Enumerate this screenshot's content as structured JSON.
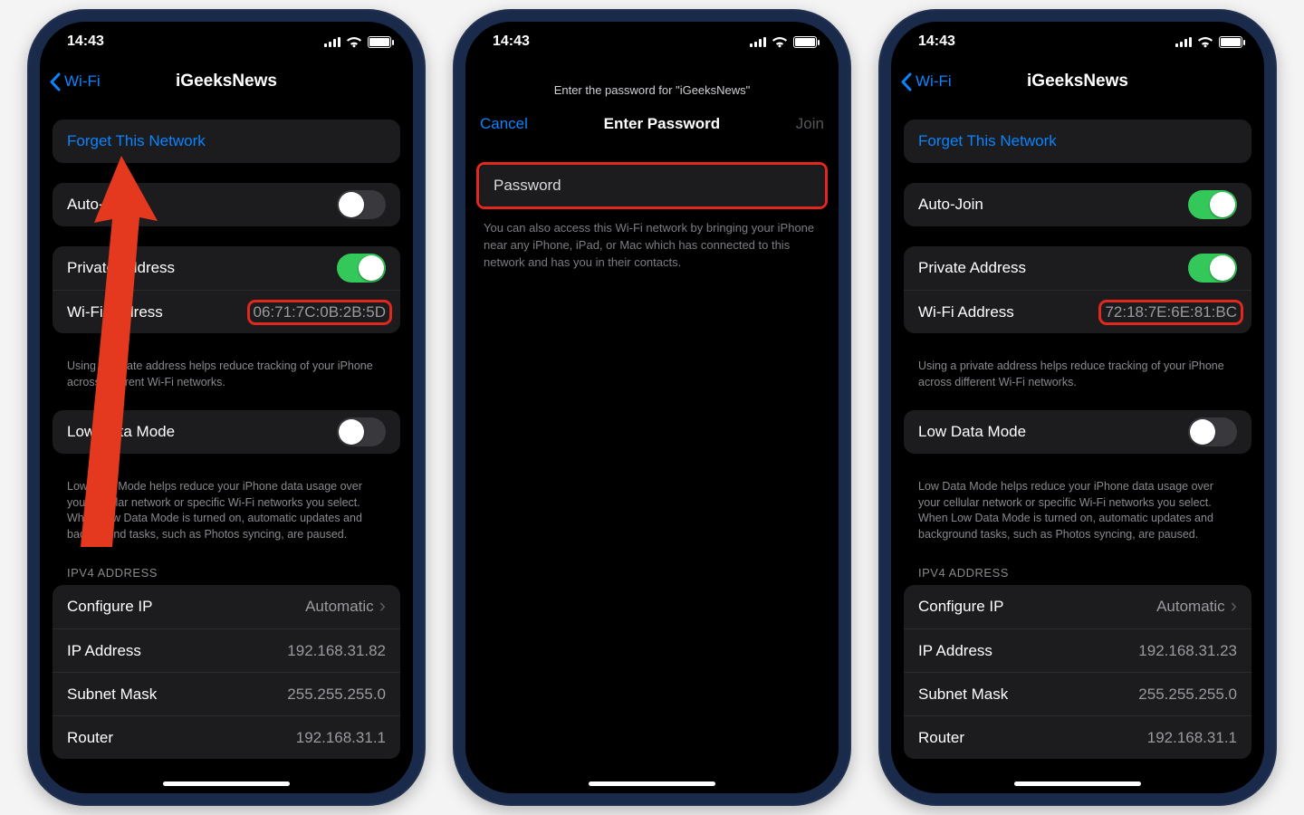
{
  "time": "14:43",
  "network_name": "iGeeksNews",
  "back_label": "Wi-Fi",
  "phoneA": {
    "forget": "Forget This Network",
    "auto_join_label": "Auto-Join",
    "auto_join_on": false,
    "private_addr_label": "Private Address",
    "private_addr_on": true,
    "wifi_addr_label": "Wi-Fi Address",
    "wifi_addr_value": "06:71:7C:0B:2B:5D",
    "private_footer": "Using a private address helps reduce tracking of your iPhone across different Wi-Fi networks.",
    "low_data_label": "Low Data Mode",
    "low_data_on": false,
    "low_data_footer": "Low Data Mode helps reduce your iPhone data usage over your cellular network or specific Wi-Fi networks you select. When Low Data Mode is turned on, automatic updates and background tasks, such as Photos syncing, are paused.",
    "ipv4_header": "IPV4 ADDRESS",
    "configure_ip_label": "Configure IP",
    "configure_ip_value": "Automatic",
    "ip_addr_label": "IP Address",
    "ip_addr_value": "192.168.31.82",
    "subnet_label": "Subnet Mask",
    "subnet_value": "255.255.255.0",
    "router_label": "Router",
    "router_value": "192.168.31.1"
  },
  "phoneB": {
    "prompt": "Enter the password for \"iGeeksNews\"",
    "cancel": "Cancel",
    "title": "Enter Password",
    "join": "Join",
    "password_label": "Password",
    "note": "You can also access this Wi-Fi network by bringing your iPhone near any iPhone, iPad, or Mac which has connected to this network and has you in their contacts."
  },
  "phoneC": {
    "forget": "Forget This Network",
    "auto_join_label": "Auto-Join",
    "auto_join_on": true,
    "private_addr_label": "Private Address",
    "private_addr_on": true,
    "wifi_addr_label": "Wi-Fi Address",
    "wifi_addr_value": "72:18:7E:6E:81:BC",
    "private_footer": "Using a private address helps reduce tracking of your iPhone across different Wi-Fi networks.",
    "low_data_label": "Low Data Mode",
    "low_data_on": false,
    "low_data_footer": "Low Data Mode helps reduce your iPhone data usage over your cellular network or specific Wi-Fi networks you select. When Low Data Mode is turned on, automatic updates and background tasks, such as Photos syncing, are paused.",
    "ipv4_header": "IPV4 ADDRESS",
    "configure_ip_label": "Configure IP",
    "configure_ip_value": "Automatic",
    "ip_addr_label": "IP Address",
    "ip_addr_value": "192.168.31.23",
    "subnet_label": "Subnet Mask",
    "subnet_value": "255.255.255.0",
    "router_label": "Router",
    "router_value": "192.168.31.1"
  }
}
